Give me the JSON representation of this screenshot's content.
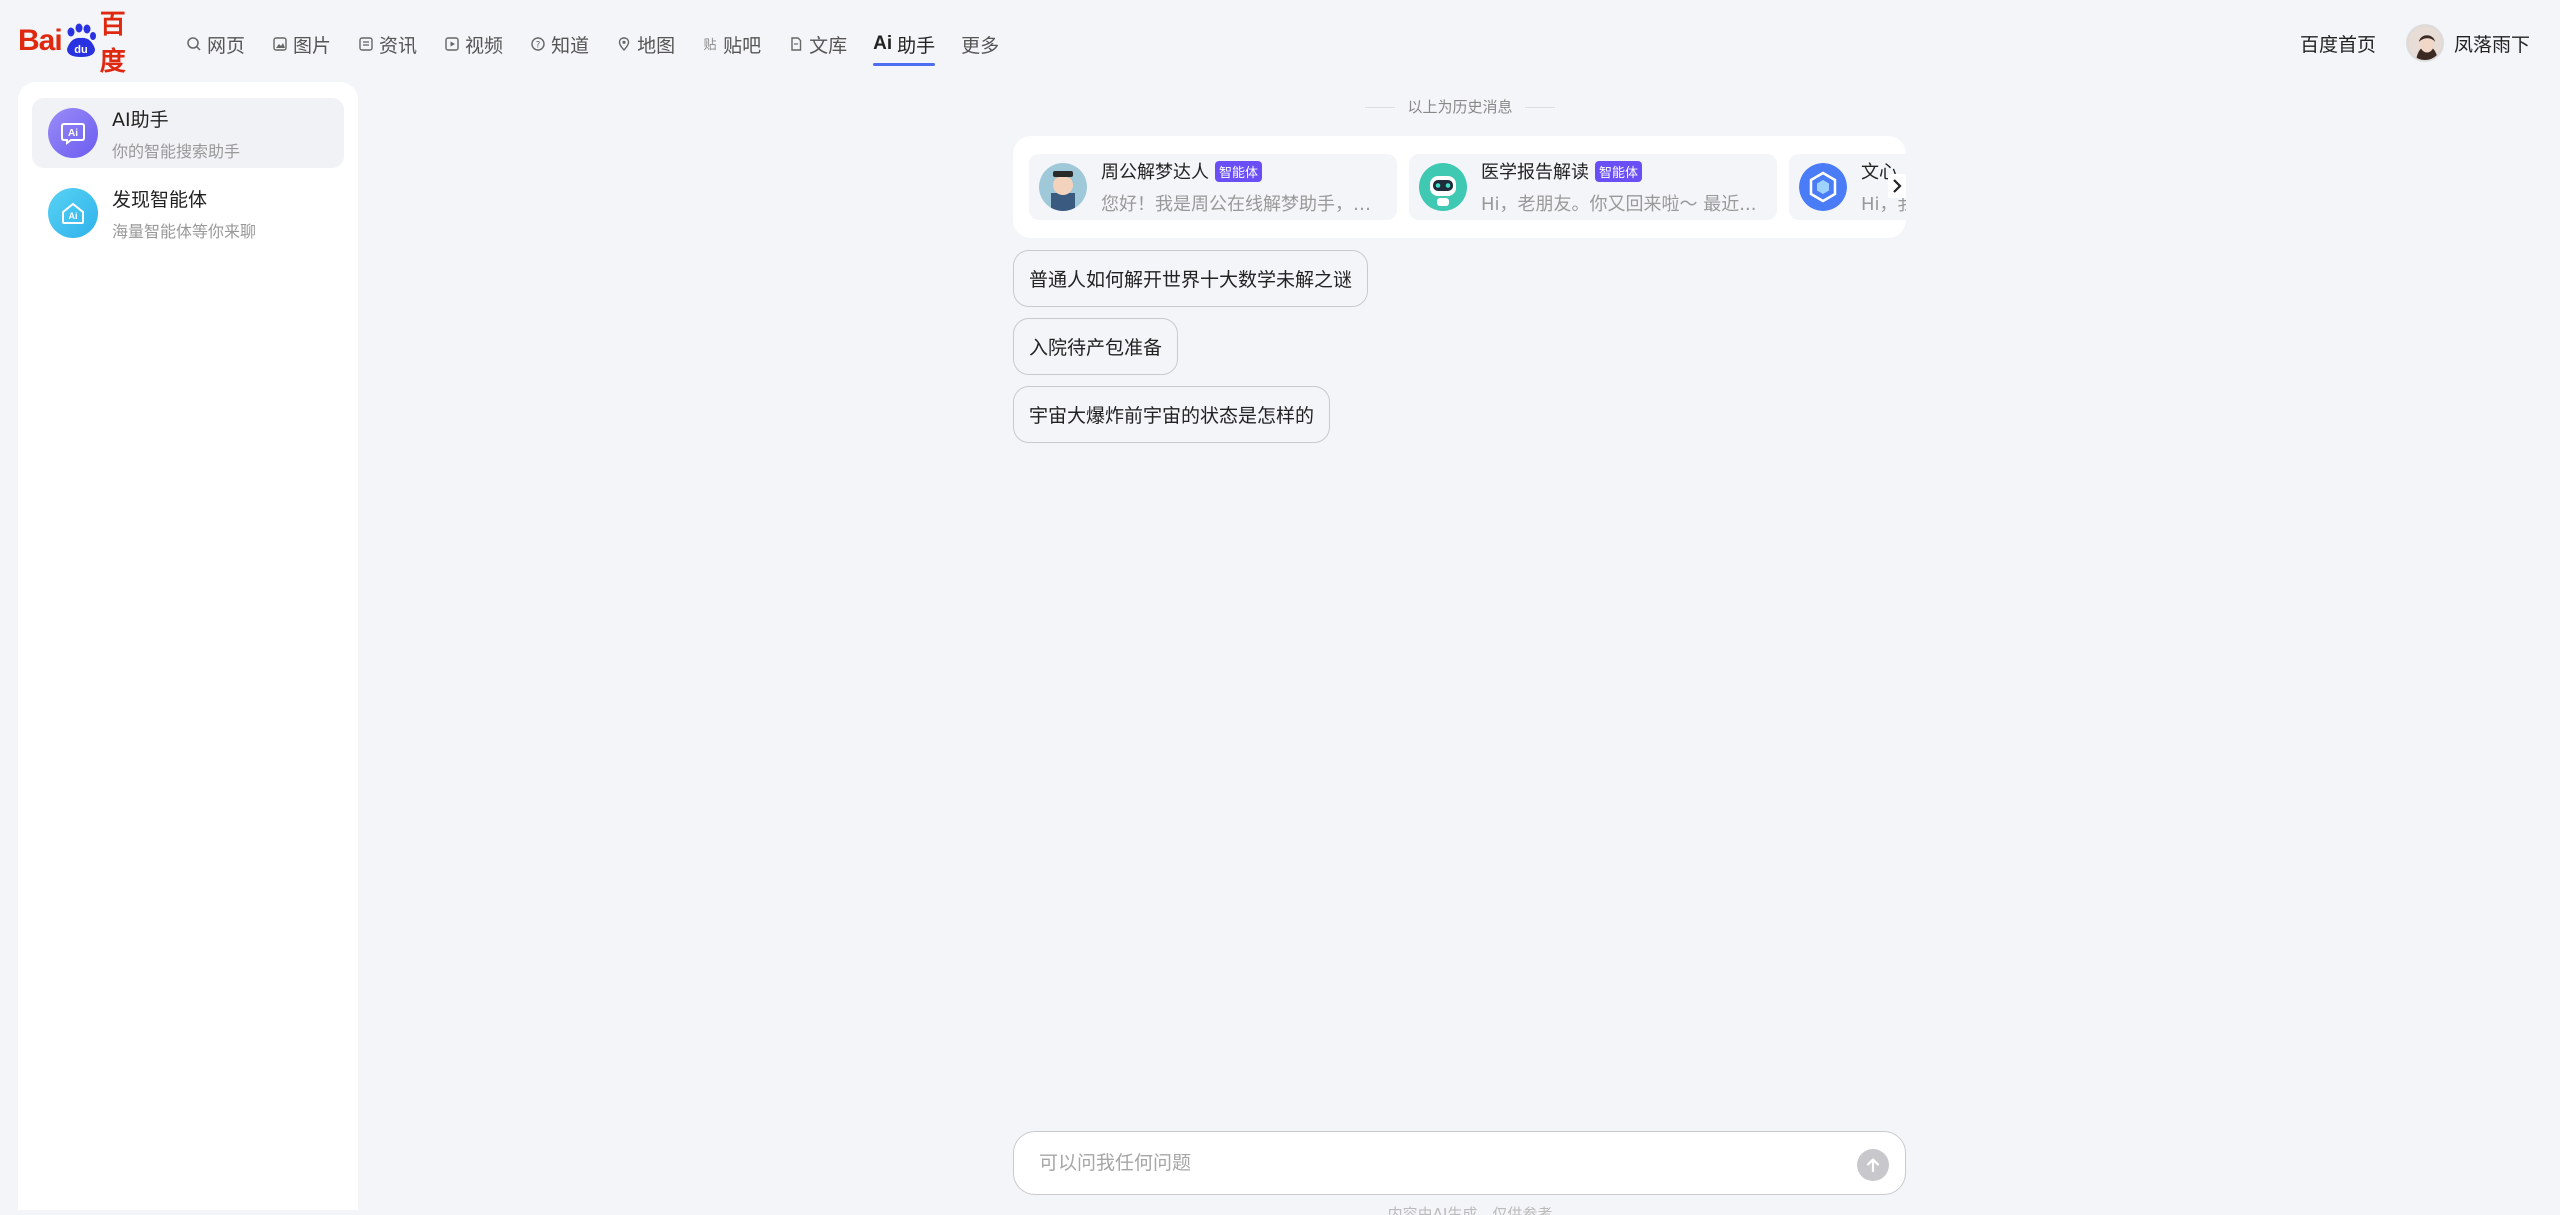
{
  "logo": {
    "bai": "Bai",
    "du": "du",
    "cn": "百度"
  },
  "nav": [
    {
      "label": "网页",
      "icon": "search-icon"
    },
    {
      "label": "图片",
      "icon": "image-icon"
    },
    {
      "label": "资讯",
      "icon": "news-icon"
    },
    {
      "label": "视频",
      "icon": "video-icon"
    },
    {
      "label": "知道",
      "icon": "question-icon"
    },
    {
      "label": "地图",
      "icon": "map-icon"
    },
    {
      "label": "贴吧",
      "icon": "tieba-icon"
    },
    {
      "label": "文库",
      "icon": "doc-icon"
    },
    {
      "label": "助手",
      "icon": "ai-icon",
      "prefix": "Ai",
      "active": true
    },
    {
      "label": "更多"
    }
  ],
  "topright": {
    "home": "百度首页",
    "username": "凤落雨下"
  },
  "sidebar": {
    "items": [
      {
        "title": "AI助手",
        "subtitle": "你的智能搜索助手",
        "icon_text": "Ai"
      },
      {
        "title": "发现智能体",
        "subtitle": "海量智能体等你来聊",
        "icon_text": "Ai"
      }
    ]
  },
  "main": {
    "history_divider": "以上为历史消息",
    "agents": [
      {
        "name": "周公解梦达人",
        "tag": "智能体",
        "desc": "您好！我是周公在线解梦助手，无..."
      },
      {
        "name": "医学报告解读",
        "tag": "智能体",
        "desc": "Hi，老朋友。你又回来啦～ 最近..."
      },
      {
        "name": "文心",
        "tag": "",
        "desc": "Hi，我"
      }
    ],
    "suggestions": [
      "普通人如何解开世界十大数学未解之谜",
      "入院待产包准备",
      "宇宙大爆炸前宇宙的状态是怎样的"
    ],
    "input_placeholder": "可以问我任何问题",
    "footer_note": "内容由AI生成，仅供参考"
  },
  "colors": {
    "accent": "#4e6ef2",
    "tag": "#6b4ff6",
    "brand_red": "#de2910",
    "brand_blue": "#2932e1"
  }
}
